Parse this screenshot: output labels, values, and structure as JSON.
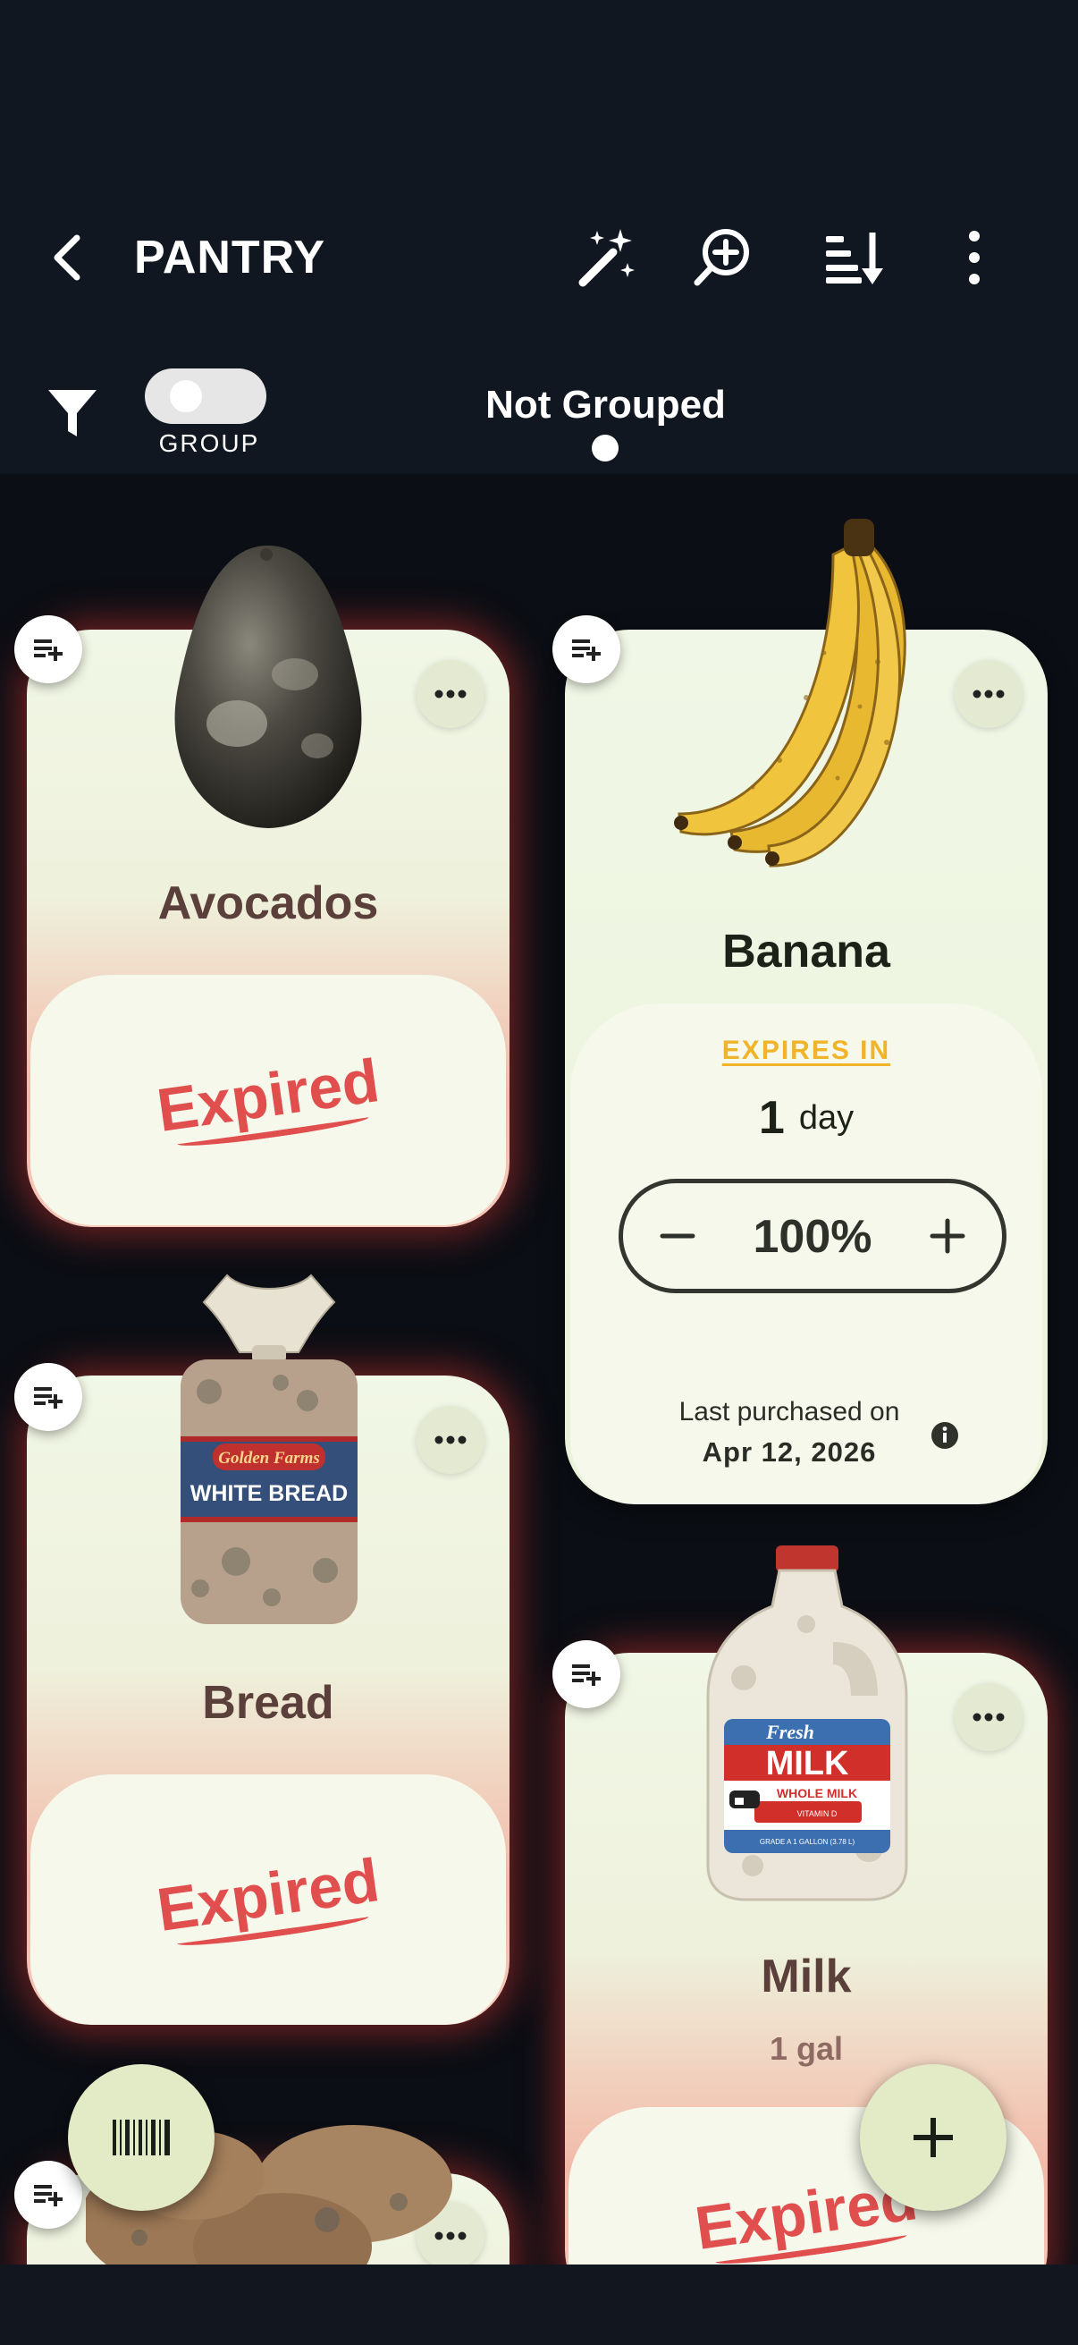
{
  "header": {
    "title": "PANTRY",
    "actions": [
      "magic-wand-icon",
      "zoom-in-icon",
      "sort-icon",
      "more-vert-icon"
    ]
  },
  "toolbar": {
    "group_label": "GROUP",
    "group_enabled": false,
    "grouping_mode": "Not Grouped"
  },
  "items": [
    {
      "name": "Avocados",
      "status": "Expired"
    },
    {
      "name": "Banana",
      "expires_label": "EXPIRES IN",
      "expires_value": "1",
      "expires_unit": "day",
      "percent": "100%",
      "purchased_label": "Last purchased on",
      "purchased_date": "Apr 12, 2026"
    },
    {
      "name": "Bread",
      "status": "Expired"
    },
    {
      "name": "Milk",
      "quantity": "1 gal",
      "status": "Expired"
    }
  ],
  "product_labels": {
    "bread_brand": "Golden Farms",
    "bread_type": "WHITE BREAD",
    "milk_fresh": "Fresh",
    "milk_brand": "MILK",
    "milk_type": "WHOLE MILK",
    "milk_vitamin": "VITAMIN D",
    "milk_grade": "GRADE A 1 GALLON (3.78 L)"
  },
  "fabs": [
    "barcode-icon",
    "plus-icon"
  ],
  "colors": {
    "background": "#0b0e14",
    "card": "#f1f7e6",
    "expired": "#e04e4e",
    "expires_accent": "#f0b429",
    "fab": "#e3ebc6"
  }
}
